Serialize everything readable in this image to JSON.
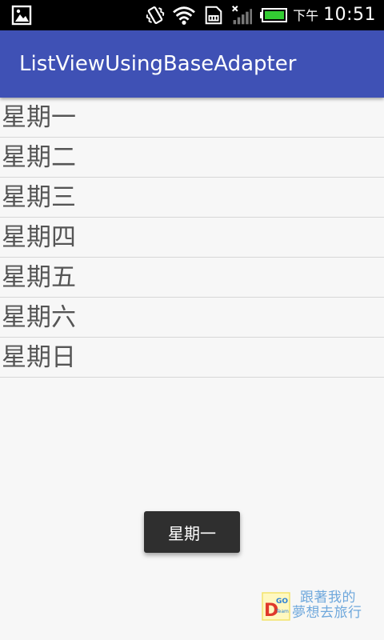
{
  "status_bar": {
    "icons": [
      "image-icon",
      "vibrate-icon",
      "wifi-icon",
      "sd-card-icon",
      "signal-off-icon",
      "battery-icon"
    ],
    "ampm": "下午",
    "time": "10:51",
    "battery_color": "#33cc33"
  },
  "app_bar": {
    "title": "ListViewUsingBaseAdapter",
    "color": "#3f51b5"
  },
  "list": {
    "items": [
      {
        "label": "星期一"
      },
      {
        "label": "星期二"
      },
      {
        "label": "星期三"
      },
      {
        "label": "星期四"
      },
      {
        "label": "星期五"
      },
      {
        "label": "星期六"
      },
      {
        "label": "星期日"
      }
    ]
  },
  "toast": {
    "text": "星期一"
  },
  "watermark": {
    "logo_letter": "D",
    "logo_go": "GO",
    "logo_team": "Team",
    "line1": "跟著我的",
    "line2": "夢想去旅行"
  }
}
